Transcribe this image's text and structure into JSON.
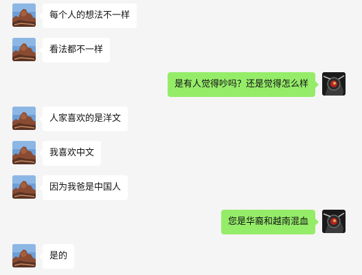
{
  "messages": [
    {
      "side": "in",
      "text": "每个人的想法不一样"
    },
    {
      "side": "in",
      "text": "看法都不一样"
    },
    {
      "side": "out",
      "text": "是有人觉得吵吗？还是觉得怎么样"
    },
    {
      "side": "in",
      "text": "人家喜欢的是洋文"
    },
    {
      "side": "in",
      "text": "我喜欢中文"
    },
    {
      "side": "in",
      "text": "因为我爸是中国人"
    },
    {
      "side": "out",
      "text": "您是华裔和越南混血"
    },
    {
      "side": "in",
      "text": "是的"
    }
  ],
  "colors": {
    "background": "#f5f5f5",
    "incoming_bubble": "#ffffff",
    "outgoing_bubble": "#95ec69"
  },
  "icons": {
    "contact_avatar": "rock-landscape-avatar",
    "self_avatar": "dark-helmet-avatar"
  }
}
